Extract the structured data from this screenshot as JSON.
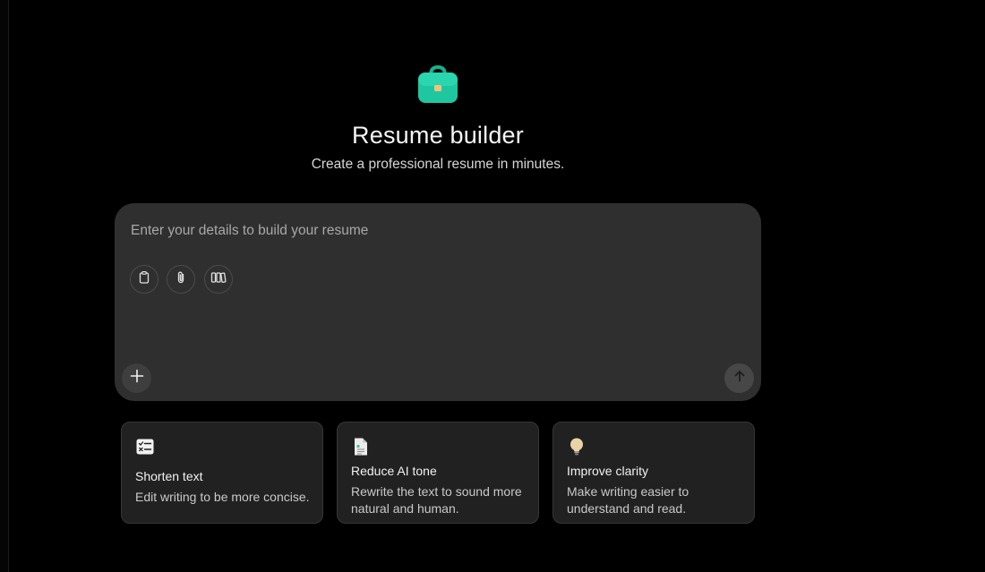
{
  "colors": {
    "background": "#000000",
    "composer_bg": "#2f2f2f",
    "card_bg": "#212121",
    "accent": "#1fc7a0"
  },
  "hero": {
    "icon": "briefcase-icon",
    "title": "Resume builder",
    "subtitle": "Create a professional resume in minutes."
  },
  "composer": {
    "placeholder": "Enter your details to build your resume",
    "value": "",
    "tools": [
      {
        "icon": "clipboard-icon"
      },
      {
        "icon": "paperclip-icon"
      },
      {
        "icon": "library-icon"
      }
    ],
    "plus_icon": "plus-icon",
    "send_icon": "arrow-up-icon"
  },
  "suggestions": [
    {
      "icon": "checklist-icon",
      "title": "Shorten text",
      "description": "Edit writing to be more concise."
    },
    {
      "icon": "document-icon",
      "title": "Reduce AI tone",
      "description": "Rewrite the text to sound more natural and human."
    },
    {
      "icon": "lightbulb-icon",
      "title": "Improve clarity",
      "description": "Make writing easier to understand and read."
    }
  ]
}
